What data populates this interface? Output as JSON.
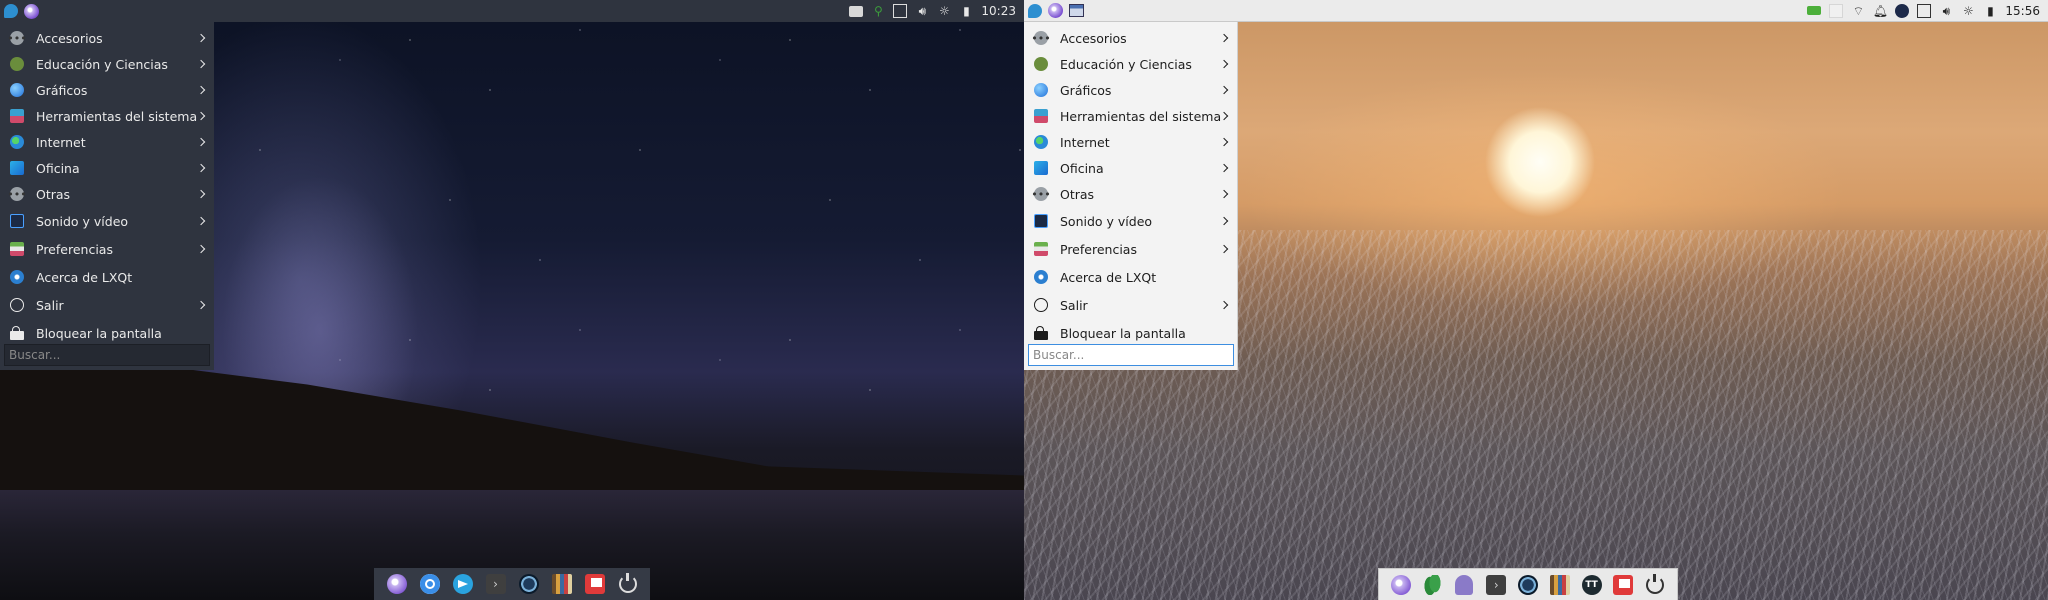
{
  "screens": [
    {
      "theme": "dark",
      "clock": "10:23",
      "tray_icons": [
        "media-icon",
        "network-signal-icon",
        "window-icon",
        "volume-icon",
        "brightness-icon",
        "battery-icon"
      ],
      "menu": {
        "items": [
          {
            "label": "Accesorios",
            "icon": "accessories-icon",
            "submenu": true
          },
          {
            "label": "Educación y Ciencias",
            "icon": "education-icon",
            "submenu": true
          },
          {
            "label": "Gráficos",
            "icon": "graphics-icon",
            "submenu": true
          },
          {
            "label": "Herramientas del sistema",
            "icon": "system-tools-icon",
            "submenu": true
          },
          {
            "label": "Internet",
            "icon": "internet-icon",
            "submenu": true
          },
          {
            "label": "Oficina",
            "icon": "office-icon",
            "submenu": true
          },
          {
            "label": "Otras",
            "icon": "other-icon",
            "submenu": true
          },
          {
            "label": "Sonido y vídeo",
            "icon": "sound-video-icon",
            "submenu": true
          },
          {
            "label": "Preferencias",
            "icon": "preferences-icon",
            "submenu": true
          },
          {
            "label": "Acerca de LXQt",
            "icon": "about-icon",
            "submenu": false
          },
          {
            "label": "Salir",
            "icon": "exit-icon",
            "submenu": true
          },
          {
            "label": "Bloquear la pantalla",
            "icon": "lock-icon",
            "submenu": false
          }
        ],
        "search_placeholder": "Buscar..."
      },
      "dock_icons": [
        "orb-app-icon",
        "chat-icon",
        "telegram-icon",
        "terminal-icon",
        "spotify-icon",
        "books-icon",
        "flag-app-icon",
        "power-icon"
      ]
    },
    {
      "theme": "light",
      "clock": "15:56",
      "tray_icons": [
        "battery-status-icon",
        "blank-icon",
        "wifi-icon",
        "notification-bell-icon",
        "circle-app-icon",
        "window-icon",
        "volume-icon",
        "brightness-icon",
        "battery-icon"
      ],
      "menu": {
        "items": [
          {
            "label": "Accesorios",
            "icon": "accessories-icon",
            "submenu": true
          },
          {
            "label": "Educación y Ciencias",
            "icon": "education-icon",
            "submenu": true
          },
          {
            "label": "Gráficos",
            "icon": "graphics-icon",
            "submenu": true
          },
          {
            "label": "Herramientas del sistema",
            "icon": "system-tools-icon",
            "submenu": true
          },
          {
            "label": "Internet",
            "icon": "internet-icon",
            "submenu": true
          },
          {
            "label": "Oficina",
            "icon": "office-icon",
            "submenu": true
          },
          {
            "label": "Otras",
            "icon": "other-icon",
            "submenu": true
          },
          {
            "label": "Sonido y vídeo",
            "icon": "sound-video-icon",
            "submenu": true
          },
          {
            "label": "Preferencias",
            "icon": "preferences-icon",
            "submenu": true
          },
          {
            "label": "Acerca de LXQt",
            "icon": "about-icon",
            "submenu": false
          },
          {
            "label": "Salir",
            "icon": "exit-icon",
            "submenu": true
          },
          {
            "label": "Bloquear la pantalla",
            "icon": "lock-icon",
            "submenu": false
          }
        ],
        "search_placeholder": "Buscar..."
      },
      "dock_icons": [
        "orb-app-icon",
        "leaf-app-icon",
        "ghost-app-icon",
        "terminal-icon",
        "spotify-icon",
        "books-icon",
        "disc-app-icon",
        "flag-app-icon",
        "power-icon"
      ],
      "dock_disc_label": "TT"
    }
  ]
}
